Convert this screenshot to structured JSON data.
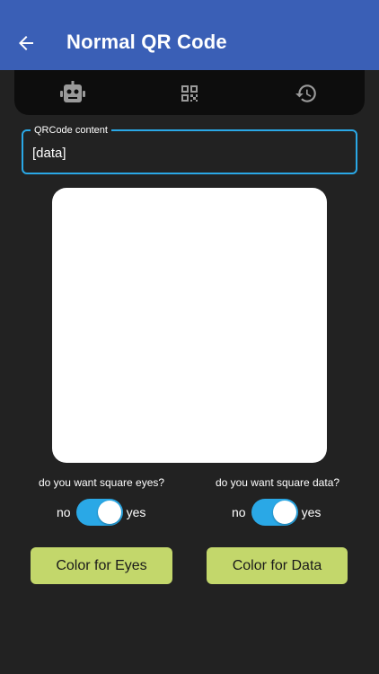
{
  "appbar": {
    "title": "Normal QR Code"
  },
  "tabs": [
    {
      "name": "robot"
    },
    {
      "name": "qr-code"
    },
    {
      "name": "history"
    }
  ],
  "input": {
    "label": "QRCode content",
    "value": "[data]"
  },
  "options": {
    "eyes": {
      "question": "do you want square eyes?",
      "no": "no",
      "yes": "yes",
      "enabled": true
    },
    "data": {
      "question": "do you want square data?",
      "no": "no",
      "yes": "yes",
      "enabled": true
    }
  },
  "buttons": {
    "eyes_color": "Color for Eyes",
    "data_color": "Color for Data"
  },
  "colors": {
    "appbar": "#3a5fb6",
    "accent": "#2aa8e6",
    "button": "#c3d76b",
    "background": "#222222"
  }
}
